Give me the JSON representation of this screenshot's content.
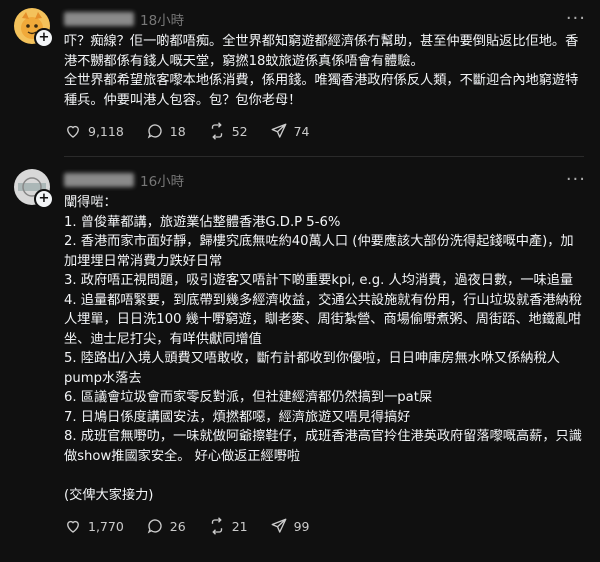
{
  "posts": [
    {
      "time": "18小時",
      "text": "吓？痴線？佢一啲都唔痴。全世界都知窮遊都經濟係冇幫助，甚至仲要倒貼返比佢地。香港不嬲都係有錢人嘅天堂，窮撚18蚊旅遊係真係唔會有體驗。\n全世界都希望旅客嚟本地係消費，係用錢。唯獨香港政府係反人類，不斷迎合內地窮遊特種兵。仲要叫港人包容。包？包你老母！",
      "likes": "9,118",
      "comments": "18",
      "reposts": "52",
      "shares": "74"
    },
    {
      "time": "16小時",
      "text": "闡得啱：\n1. 曾俊華都講，旅遊業佔整體香港G.D.P 5-6%\n2. 香港而家市面好靜，歸樓究底無咗約40萬人口 (仲要應該大部份洗得起錢嘅中產)，加加埋埋日常消費力跌好日常\n3. 政府唔正視問題，吸引遊客又唔計下啲重要kpi, e.g. 人均消費，過夜日數，一味追量\n4. 追量都唔緊要，到底帶到幾多經濟收益，交通公共設施就有份用，行山垃圾就香港納稅人埋單，日日洗100 幾十嘢窮遊，瞓老麥、周街紮營、商場偷嘢煮粥、周街踎、地鐵亂咁坐、迪士尼打尖，有咩供獻同增值\n5. 陸路出/入境人頭費又唔敢收，斷冇計都收到你優啦，日日呻庫房無水咻又係納稅人pump水落去\n6. 區議會垃圾會而家零反對派，但社建經濟都仍然搞到一pat屎\n7. 日鳩日係度講國安法，煩撚都噁，經濟旅遊又唔見得搞好\n8. 成班官無嘢叻，一味就做阿爺擦鞋仔，成班香港高官拎住港英政府留落嚟嘅高薪，只識做show推國家安全。 好心做返正經嘢啦\n\n(交俾大家接力)",
      "likes": "1,770",
      "comments": "26",
      "reposts": "21",
      "shares": "99"
    }
  ],
  "colors": {
    "background": "#101010",
    "text": "#f3f5f7",
    "muted": "#777777"
  }
}
